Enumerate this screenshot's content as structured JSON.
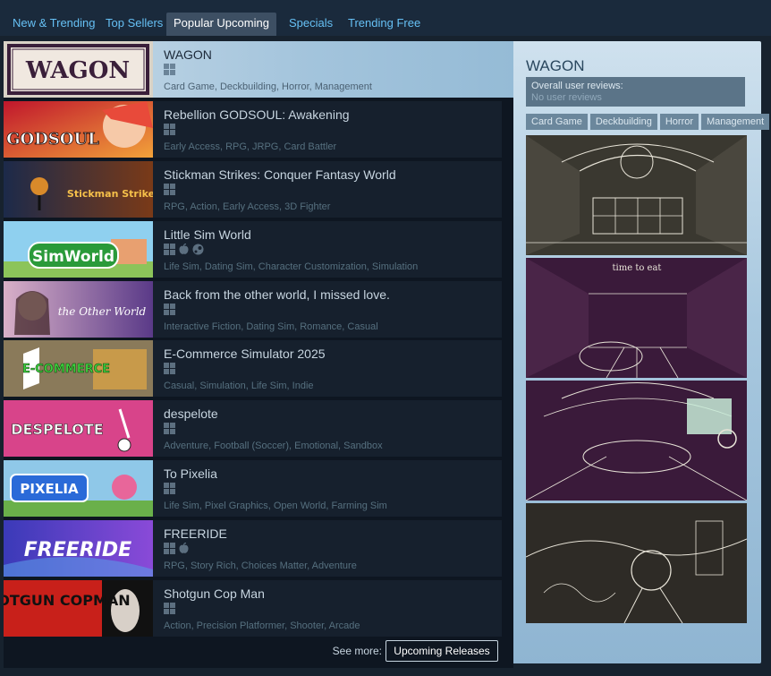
{
  "tabs": [
    {
      "label": "New & Trending"
    },
    {
      "label": "Top Sellers"
    },
    {
      "label": "Popular Upcoming"
    },
    {
      "label": "Specials"
    },
    {
      "label": "Trending Free"
    }
  ],
  "games": [
    {
      "title": "WAGON",
      "platforms": [
        "windows"
      ],
      "tags": "Card Game, Deckbuilding, Horror, Management",
      "capsule_text": "WAGON"
    },
    {
      "title": "Rebellion GODSOUL: Awakening",
      "platforms": [
        "windows"
      ],
      "tags": "Early Access, RPG, JRPG, Card Battler",
      "capsule_text": "GODSOUL"
    },
    {
      "title": "Stickman Strikes: Conquer Fantasy World",
      "platforms": [
        "windows"
      ],
      "tags": "RPG, Action, Early Access, 3D Fighter",
      "capsule_text": "Stickman Strike"
    },
    {
      "title": "Little Sim World",
      "platforms": [
        "windows",
        "mac",
        "steam"
      ],
      "tags": "Life Sim, Dating Sim, Character Customization, Simulation",
      "capsule_text": "SimWorld"
    },
    {
      "title": "Back from the other world, I missed love.",
      "platforms": [
        "windows"
      ],
      "tags": "Interactive Fiction, Dating Sim, Romance, Casual",
      "capsule_text": "the Other World"
    },
    {
      "title": "E-Commerce Simulator 2025",
      "platforms": [
        "windows"
      ],
      "tags": "Casual, Simulation, Life Sim, Indie",
      "capsule_text": "E-COMMERCE"
    },
    {
      "title": "despelote",
      "platforms": [
        "windows"
      ],
      "tags": "Adventure, Football (Soccer), Emotional, Sandbox",
      "capsule_text": "DESPELOTE"
    },
    {
      "title": "To Pixelia",
      "platforms": [
        "windows"
      ],
      "tags": "Life Sim, Pixel Graphics, Open World, Farming Sim",
      "capsule_text": "PIXELIA"
    },
    {
      "title": "FREERIDE",
      "platforms": [
        "windows",
        "mac"
      ],
      "tags": "RPG, Story Rich, Choices Matter, Adventure",
      "capsule_text": "FREERIDE"
    },
    {
      "title": "Shotgun Cop Man",
      "platforms": [
        "windows"
      ],
      "tags": "Action, Precision Platformer, Shooter, Arcade",
      "capsule_text": "SHOTGUN COPMAN"
    }
  ],
  "see_more": {
    "label": "See more:",
    "button": "Upcoming Releases"
  },
  "detail": {
    "title": "WAGON",
    "reviews_label": "Overall user reviews:",
    "reviews_value": "No user reviews",
    "tags": [
      "Card Game",
      "Deckbuilding",
      "Horror",
      "Management"
    ],
    "screenshot_2_text": "time to eat"
  },
  "colors": {
    "background": "#1b2838",
    "link": "#66c0f4",
    "active_tab": "#3d4f63",
    "row": "#16202d",
    "detail_top": "#cfe1ee",
    "detail_bottom": "#8fb5d2"
  }
}
